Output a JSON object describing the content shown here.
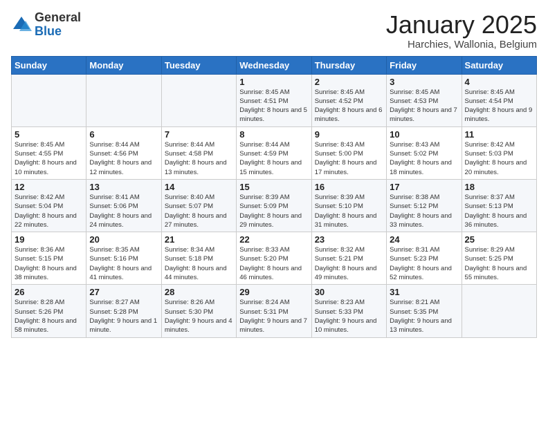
{
  "header": {
    "logo_general": "General",
    "logo_blue": "Blue",
    "month_title": "January 2025",
    "location": "Harchies, Wallonia, Belgium"
  },
  "weekdays": [
    "Sunday",
    "Monday",
    "Tuesday",
    "Wednesday",
    "Thursday",
    "Friday",
    "Saturday"
  ],
  "weeks": [
    [
      {
        "day": "",
        "info": ""
      },
      {
        "day": "",
        "info": ""
      },
      {
        "day": "",
        "info": ""
      },
      {
        "day": "1",
        "info": "Sunrise: 8:45 AM\nSunset: 4:51 PM\nDaylight: 8 hours\nand 5 minutes."
      },
      {
        "day": "2",
        "info": "Sunrise: 8:45 AM\nSunset: 4:52 PM\nDaylight: 8 hours\nand 6 minutes."
      },
      {
        "day": "3",
        "info": "Sunrise: 8:45 AM\nSunset: 4:53 PM\nDaylight: 8 hours\nand 7 minutes."
      },
      {
        "day": "4",
        "info": "Sunrise: 8:45 AM\nSunset: 4:54 PM\nDaylight: 8 hours\nand 9 minutes."
      }
    ],
    [
      {
        "day": "5",
        "info": "Sunrise: 8:45 AM\nSunset: 4:55 PM\nDaylight: 8 hours\nand 10 minutes."
      },
      {
        "day": "6",
        "info": "Sunrise: 8:44 AM\nSunset: 4:56 PM\nDaylight: 8 hours\nand 12 minutes."
      },
      {
        "day": "7",
        "info": "Sunrise: 8:44 AM\nSunset: 4:58 PM\nDaylight: 8 hours\nand 13 minutes."
      },
      {
        "day": "8",
        "info": "Sunrise: 8:44 AM\nSunset: 4:59 PM\nDaylight: 8 hours\nand 15 minutes."
      },
      {
        "day": "9",
        "info": "Sunrise: 8:43 AM\nSunset: 5:00 PM\nDaylight: 8 hours\nand 17 minutes."
      },
      {
        "day": "10",
        "info": "Sunrise: 8:43 AM\nSunset: 5:02 PM\nDaylight: 8 hours\nand 18 minutes."
      },
      {
        "day": "11",
        "info": "Sunrise: 8:42 AM\nSunset: 5:03 PM\nDaylight: 8 hours\nand 20 minutes."
      }
    ],
    [
      {
        "day": "12",
        "info": "Sunrise: 8:42 AM\nSunset: 5:04 PM\nDaylight: 8 hours\nand 22 minutes."
      },
      {
        "day": "13",
        "info": "Sunrise: 8:41 AM\nSunset: 5:06 PM\nDaylight: 8 hours\nand 24 minutes."
      },
      {
        "day": "14",
        "info": "Sunrise: 8:40 AM\nSunset: 5:07 PM\nDaylight: 8 hours\nand 27 minutes."
      },
      {
        "day": "15",
        "info": "Sunrise: 8:39 AM\nSunset: 5:09 PM\nDaylight: 8 hours\nand 29 minutes."
      },
      {
        "day": "16",
        "info": "Sunrise: 8:39 AM\nSunset: 5:10 PM\nDaylight: 8 hours\nand 31 minutes."
      },
      {
        "day": "17",
        "info": "Sunrise: 8:38 AM\nSunset: 5:12 PM\nDaylight: 8 hours\nand 33 minutes."
      },
      {
        "day": "18",
        "info": "Sunrise: 8:37 AM\nSunset: 5:13 PM\nDaylight: 8 hours\nand 36 minutes."
      }
    ],
    [
      {
        "day": "19",
        "info": "Sunrise: 8:36 AM\nSunset: 5:15 PM\nDaylight: 8 hours\nand 38 minutes."
      },
      {
        "day": "20",
        "info": "Sunrise: 8:35 AM\nSunset: 5:16 PM\nDaylight: 8 hours\nand 41 minutes."
      },
      {
        "day": "21",
        "info": "Sunrise: 8:34 AM\nSunset: 5:18 PM\nDaylight: 8 hours\nand 44 minutes."
      },
      {
        "day": "22",
        "info": "Sunrise: 8:33 AM\nSunset: 5:20 PM\nDaylight: 8 hours\nand 46 minutes."
      },
      {
        "day": "23",
        "info": "Sunrise: 8:32 AM\nSunset: 5:21 PM\nDaylight: 8 hours\nand 49 minutes."
      },
      {
        "day": "24",
        "info": "Sunrise: 8:31 AM\nSunset: 5:23 PM\nDaylight: 8 hours\nand 52 minutes."
      },
      {
        "day": "25",
        "info": "Sunrise: 8:29 AM\nSunset: 5:25 PM\nDaylight: 8 hours\nand 55 minutes."
      }
    ],
    [
      {
        "day": "26",
        "info": "Sunrise: 8:28 AM\nSunset: 5:26 PM\nDaylight: 8 hours\nand 58 minutes."
      },
      {
        "day": "27",
        "info": "Sunrise: 8:27 AM\nSunset: 5:28 PM\nDaylight: 9 hours\nand 1 minute."
      },
      {
        "day": "28",
        "info": "Sunrise: 8:26 AM\nSunset: 5:30 PM\nDaylight: 9 hours\nand 4 minutes."
      },
      {
        "day": "29",
        "info": "Sunrise: 8:24 AM\nSunset: 5:31 PM\nDaylight: 9 hours\nand 7 minutes."
      },
      {
        "day": "30",
        "info": "Sunrise: 8:23 AM\nSunset: 5:33 PM\nDaylight: 9 hours\nand 10 minutes."
      },
      {
        "day": "31",
        "info": "Sunrise: 8:21 AM\nSunset: 5:35 PM\nDaylight: 9 hours\nand 13 minutes."
      },
      {
        "day": "",
        "info": ""
      }
    ]
  ]
}
